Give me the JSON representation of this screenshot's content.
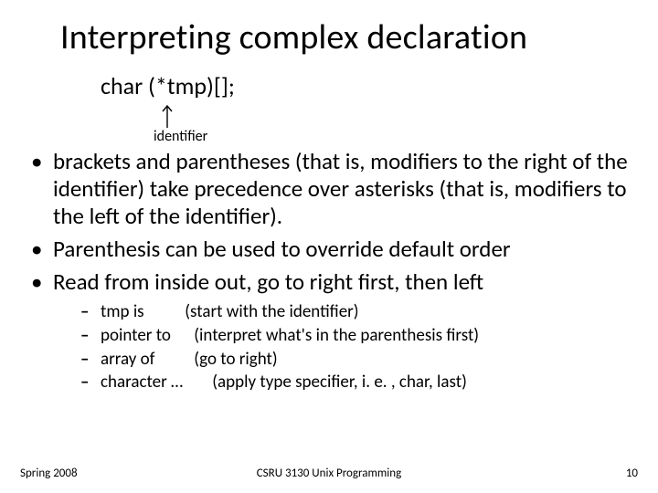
{
  "title": "Interpreting complex declaration",
  "code": "char (*tmp)[];",
  "identifier_label": "identifier",
  "bullets": [
    "brackets and parentheses (that is, modifiers to the right of the identifier) take precedence over asterisks (that is, modifiers to the left of the identifier).",
    "Parenthesis can be used to override default order",
    "Read from inside out, go to right first, then left"
  ],
  "sub_bullets": [
    {
      "lead": "tmp is",
      "paren": "(start with the identifier)"
    },
    {
      "lead": "pointer to",
      "paren": "(interpret what's in the parenthesis first)"
    },
    {
      "lead": "array of",
      "paren": "(go to right)"
    },
    {
      "lead": "character …",
      "paren": "(apply type specifier, i. e. , char, last)"
    }
  ],
  "footer": {
    "left": "Spring 2008",
    "center": "CSRU 3130 Unix Programming",
    "right": "10"
  }
}
